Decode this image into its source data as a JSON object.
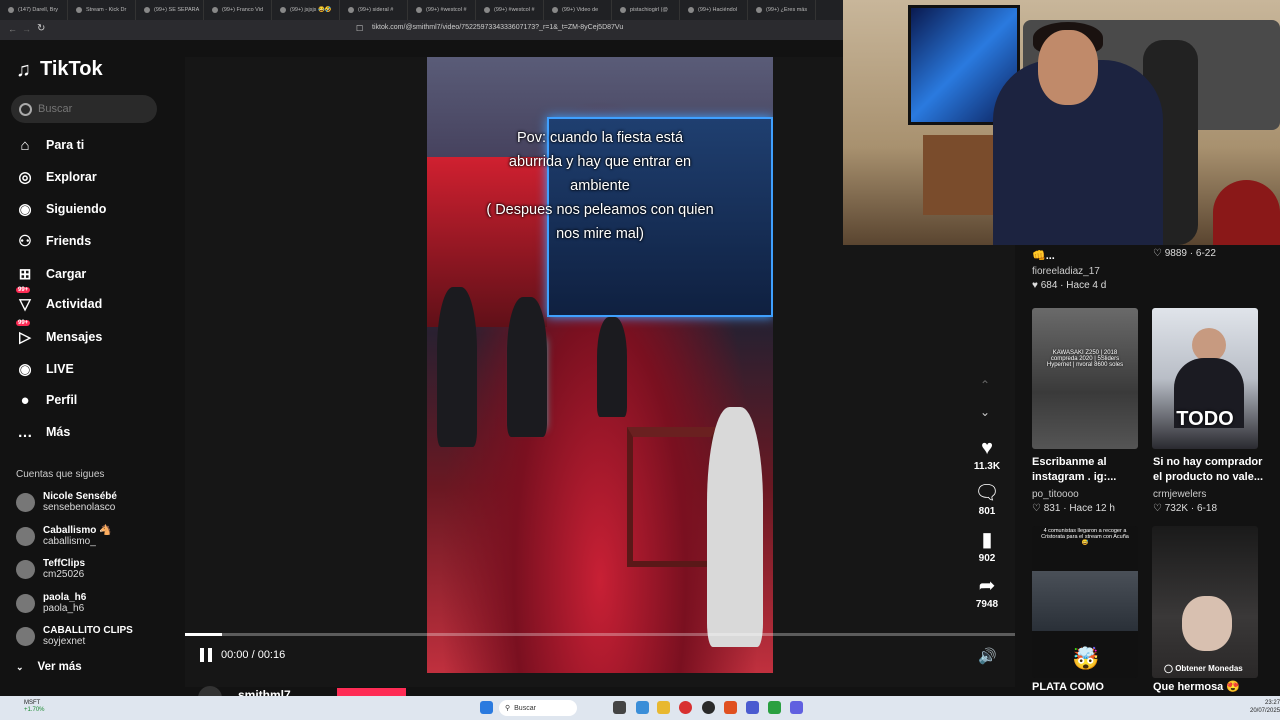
{
  "browser": {
    "tabs": [
      "(147) Darell, Bry",
      "Stream - Kick Dr",
      "(99+) SE SEPARA",
      "(99+) Franco Vid",
      "(99+) jsjsjs 😂🤣",
      "(99+) sideral #",
      "(99+) #westcol #",
      "(99+) #westcol #",
      "(99+) Video de ",
      "pistachiogirl (@",
      "(99+) Haciéndol",
      "(99+) ¿Eres más"
    ],
    "url": "tiktok.com/@smithml7/video/7522597334333607173?_r=1&_t=ZM-8yCej5D87Vu"
  },
  "sidebar": {
    "logo": "TikTok",
    "search_placeholder": "Buscar",
    "nav": [
      {
        "label": "Para ti",
        "icon": "home-icon"
      },
      {
        "label": "Explorar",
        "icon": "compass-icon"
      },
      {
        "label": "Siguiendo",
        "icon": "following-avatar-icon"
      },
      {
        "label": "Friends",
        "icon": "friends-icon"
      },
      {
        "label": "Cargar",
        "icon": "upload-icon"
      },
      {
        "label": "Actividad",
        "icon": "activity-icon",
        "badge": "99+"
      },
      {
        "label": "Mensajes",
        "icon": "messages-icon",
        "badge": "99+"
      },
      {
        "label": "LIVE",
        "icon": "live-icon"
      },
      {
        "label": "Perfil",
        "icon": "profile-icon"
      },
      {
        "label": "Más",
        "icon": "more-icon"
      }
    ],
    "following_header": "Cuentas que sigues",
    "accounts": [
      {
        "name": "Nicole Sensébé",
        "handle": "sensebenolasco"
      },
      {
        "name": "Caballismo 🐴",
        "handle": "caballismo_"
      },
      {
        "name": "TeffClips",
        "handle": "cm25026"
      },
      {
        "name": "paola_h6",
        "handle": "paola_h6"
      },
      {
        "name": "CABALLITO CLIPS",
        "handle": "soyjexnet"
      }
    ],
    "see_more": "Ver más"
  },
  "video": {
    "caption_lines": [
      "Pov: cuando la fiesta está",
      "aburrida y hay que entrar en",
      "ambiente",
      "( Despues nos peleamos con quien",
      "nos mire mal)"
    ],
    "time": "00:00 / 00:16",
    "progress": 0.045,
    "likes": "11.3K",
    "comments": "801",
    "saves": "902",
    "shares": "7948",
    "author": "smithml7"
  },
  "right_column": {
    "top_item": {
      "title": "👊...",
      "author": "fioreeladiaz_17",
      "likes": "684",
      "age": "Hace 4 d",
      "top_likes": "9889",
      "top_date": "6-22"
    },
    "cards": [
      {
        "title_lines": [
          "Escribanme al",
          "instagram . ig:..."
        ],
        "author": "po_titoooo",
        "likes": "831",
        "age": "Hace 12 h",
        "overlay": "KAWASAKI Z250 | 2018 compreda 2020 | 5Sliders Hypernet | nvoral 8600 soles"
      },
      {
        "title_lines": [
          "Si no hay comprador",
          "el producto no vale..."
        ],
        "author": "crmjewelers",
        "likes": "732K",
        "age": "6-18",
        "overlay": "TODO"
      },
      {
        "title_lines": [
          "PLATA COMO"
        ],
        "author": "",
        "likes": "",
        "age": "",
        "overlay": "4 comunistas llegaron a recoger a Cristorata para el stream con Acuña 😅"
      },
      {
        "title_lines": [
          "Que hermosa 😍"
        ],
        "author": "",
        "likes": "",
        "age": "",
        "overlay": "Obtener Monedas"
      }
    ]
  },
  "taskbar": {
    "search": "Buscar",
    "time": "23:27",
    "date": "20/07/2025",
    "stock_name": "MSFT",
    "stock_change": "+1.70%"
  },
  "colors": {
    "accent": "#fe2c55",
    "background": "#121212",
    "taskbar": "#dfe6ef"
  }
}
